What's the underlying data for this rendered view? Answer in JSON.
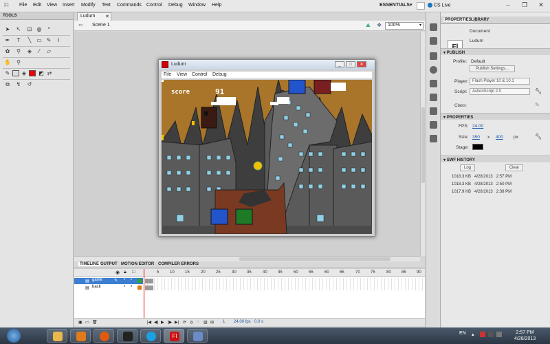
{
  "menubar": {
    "logo": "Fl",
    "items": [
      "File",
      "Edit",
      "View",
      "Insert",
      "Modify",
      "Text",
      "Commands",
      "Control",
      "Debug",
      "Window",
      "Help"
    ],
    "workspace": "ESSENTIALS",
    "cs_live": "CS Live"
  },
  "tools": {
    "header": "TOOLS"
  },
  "document": {
    "tab": "Ludum",
    "scene": "Scene 1",
    "zoom": "100%"
  },
  "swf_window": {
    "title": "Ludum",
    "menu": [
      "File",
      "View",
      "Control",
      "Debug"
    ],
    "score_label": "score",
    "score_value": "91"
  },
  "timeline": {
    "tabs": [
      "TIMELINE",
      "OUTPUT",
      "MOTION EDITOR",
      "COMPILER ERRORS"
    ],
    "frame_numbers": [
      "5",
      "10",
      "15",
      "20",
      "25",
      "30",
      "35",
      "40",
      "45",
      "50",
      "55",
      "60",
      "65",
      "70",
      "75",
      "80",
      "85",
      "90"
    ],
    "layers": [
      {
        "name": "game"
      },
      {
        "name": "back"
      }
    ],
    "footer": {
      "frame": "1",
      "fps": "24.00 fps",
      "time": "0.0 s"
    }
  },
  "properties": {
    "tabs": [
      "PROPERTIES",
      "LIBRARY"
    ],
    "doc_type": "Document",
    "doc_name": "Ludum",
    "publish_header": "PUBLISH",
    "profile_label": "Profile:",
    "profile_value": "Default",
    "publish_settings": "Publish Settings...",
    "player_label": "Player:",
    "player_value": "Flash Player 10 & 10.1",
    "script_label": "Script:",
    "script_value": "ActionScript 2.0",
    "class_label": "Class:",
    "props_header": "PROPERTIES",
    "fps_label": "FPS:",
    "fps_value": "24.00",
    "size_label": "Size:",
    "width": "350",
    "x": "x",
    "height": "400",
    "px": "px",
    "stage_label": "Stage:",
    "stage_color": "#000000",
    "history_header": "SWF HISTORY",
    "log_button": "Log",
    "clear_button": "Clear",
    "history": [
      {
        "size": "1018.3 KB",
        "date": "4/28/2013",
        "time": "2:57 PM"
      },
      {
        "size": "1018.3 KB",
        "date": "4/28/2013",
        "time": "2:50 PM"
      },
      {
        "size": "1017.9 KB",
        "date": "4/28/2013",
        "time": "2:38 PM"
      }
    ]
  },
  "taskbar": {
    "lang": "EN",
    "time": "2:57 PM",
    "date": "4/28/2013",
    "flash_label": "Fl"
  },
  "colors": {
    "accent": "#1a5aa8",
    "flash_red": "#cc1111",
    "sky": "#b07a2c"
  }
}
